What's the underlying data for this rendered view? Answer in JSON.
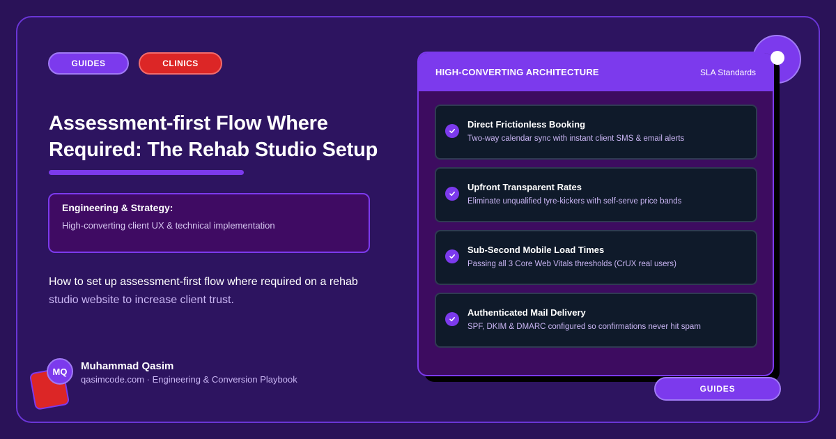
{
  "tags": {
    "guides": "GUIDES",
    "clinics": "CLINICS"
  },
  "headline": {
    "line1": "Assessment-first Flow Where",
    "line2": "Required: The Rehab Studio Setup"
  },
  "strategy": {
    "heading": "Engineering & Strategy:",
    "subtitle": "High-converting client UX & technical implementation"
  },
  "description": {
    "part1": "How to set up assessment-first flow where required on a rehab",
    "part2": "studio website to increase client trust."
  },
  "author": {
    "initials": "MQ",
    "name": "Muhammad Qasim",
    "meta": "qasimcode.com · Engineering & Conversion Playbook"
  },
  "card": {
    "title": "HIGH-CONVERTING ARCHITECTURE",
    "tag": "SLA Standards",
    "features": [
      {
        "title": "Direct Frictionless Booking",
        "desc": "Two-way calendar sync with instant client SMS & email alerts",
        "icon": "check-icon"
      },
      {
        "title": "Upfront Transparent Rates",
        "desc": "Eliminate unqualified tyre-kickers with self-serve price bands",
        "icon": "check-icon"
      },
      {
        "title": "Sub-Second Mobile Load Times",
        "desc": "Passing all 3 Core Web Vitals thresholds (CrUX real users)",
        "icon": "check-icon"
      },
      {
        "title": "Authenticated Mail Delivery",
        "desc": "SPF, DKIM & DMARC configured so confirmations never hit spam",
        "icon": "check-icon"
      }
    ]
  },
  "bottom_tag": "GUIDES",
  "colors": {
    "background": "#2a1258",
    "accent": "#7c3aed",
    "danger": "#dc2626",
    "feature_bg": "#0f1a2a",
    "muted_text": "#c9b5f3"
  }
}
